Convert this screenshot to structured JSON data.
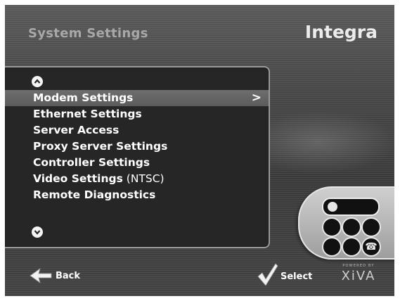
{
  "header": {
    "title": "System Settings",
    "brand": "Integra"
  },
  "menu": {
    "scroll_up_icon": "chevron-up-circle-icon",
    "scroll_down_icon": "chevron-down-circle-icon",
    "items": [
      {
        "label": "Modem Settings",
        "suffix": "",
        "selected": true,
        "submenu_indicator": ">"
      },
      {
        "label": "Ethernet Settings",
        "suffix": "",
        "selected": false
      },
      {
        "label": "Server Access",
        "suffix": "",
        "selected": false
      },
      {
        "label": "Proxy Server Settings",
        "suffix": "",
        "selected": false
      },
      {
        "label": "Controller Settings",
        "suffix": "",
        "selected": false
      },
      {
        "label": "Video Settings",
        "suffix": " (NTSC)",
        "selected": false
      },
      {
        "label": "Remote Diagnostics",
        "suffix": "",
        "selected": false
      }
    ]
  },
  "keypad": {
    "icon": "keypad-phone-icon"
  },
  "footer": {
    "back_label": "Back",
    "back_icon": "back-arrow-icon",
    "select_label": "Select",
    "select_icon": "checkmark-icon",
    "powered_by": "POWERED BY",
    "platform": "XiVA"
  },
  "colors": {
    "background": "#4a4a4a",
    "panel": "#262626",
    "highlight": "#5b5b5b",
    "text": "#ffffff",
    "title": "#a8a8a8"
  }
}
